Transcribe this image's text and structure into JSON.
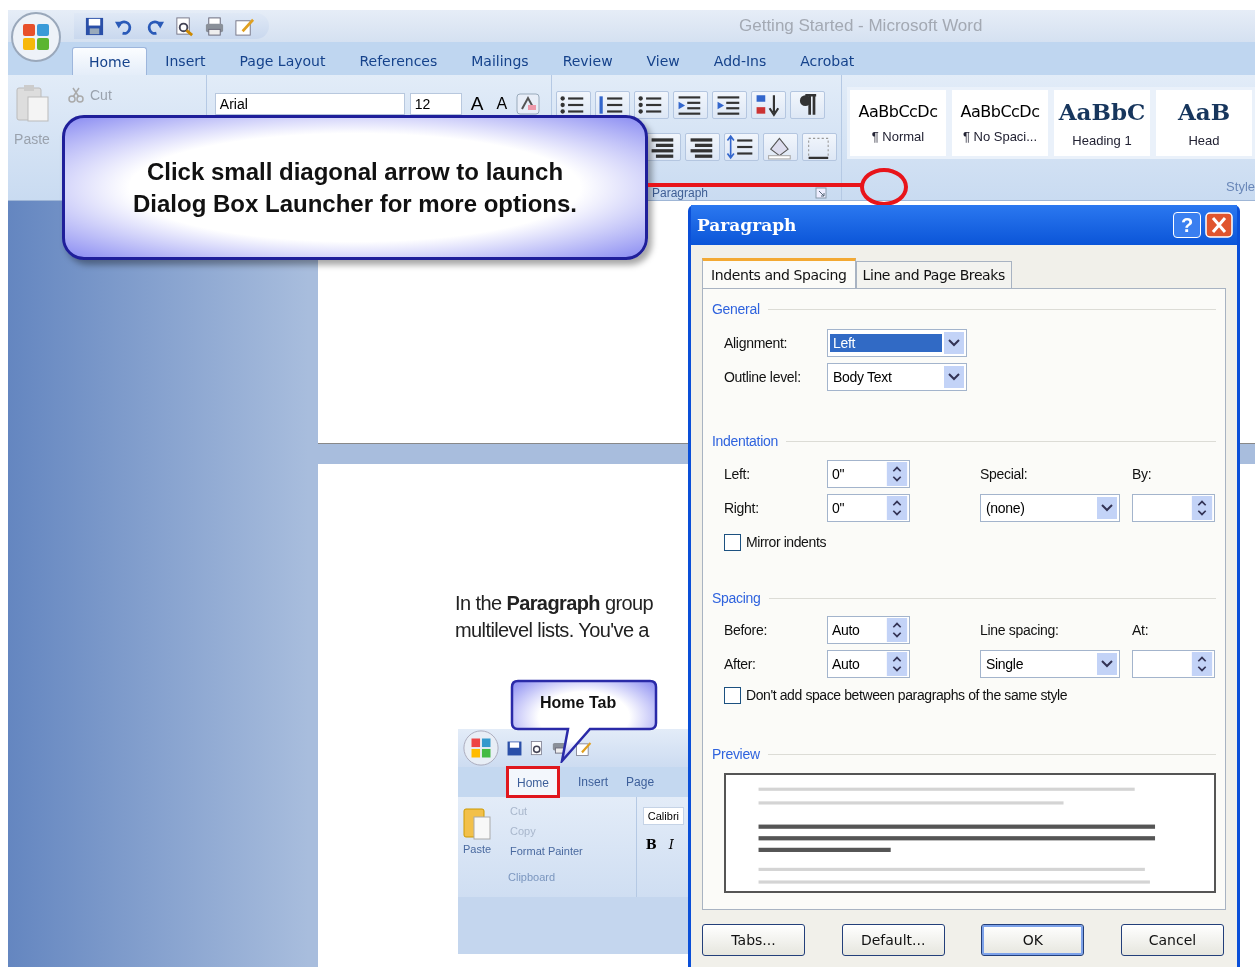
{
  "window": {
    "title": "Getting Started - Microsoft Word"
  },
  "ribbon_tabs": [
    {
      "label": "Home",
      "selected": true
    },
    {
      "label": "Insert",
      "selected": false
    },
    {
      "label": "Page Layout",
      "selected": false
    },
    {
      "label": "References",
      "selected": false
    },
    {
      "label": "Mailings",
      "selected": false
    },
    {
      "label": "Review",
      "selected": false
    },
    {
      "label": "View",
      "selected": false
    },
    {
      "label": "Add-Ins",
      "selected": false
    },
    {
      "label": "Acrobat",
      "selected": false
    }
  ],
  "ribbon": {
    "clipboard": {
      "paste": "Paste",
      "cut": "Cut"
    },
    "font": {
      "name": "Arial",
      "size": "12",
      "grow": "A",
      "shrink": "A"
    },
    "paragraph_label": "Paragraph",
    "styles": [
      {
        "sample": "AaBbCcDc",
        "name": "¶ Normal",
        "kind": "body"
      },
      {
        "sample": "AaBbCcDc",
        "name": "¶ No Spaci...",
        "kind": "body"
      },
      {
        "sample": "AaBbC",
        "name": "Heading 1",
        "kind": "heading"
      },
      {
        "sample": "AaB",
        "name": "Head",
        "kind": "heading"
      }
    ],
    "styles_label": "Style"
  },
  "callout": {
    "lines": [
      "Click small diagonal arrow to launch",
      "Dialog Box Launcher for more options."
    ]
  },
  "document": {
    "lines": [
      "In the **Paragraph** group",
      "multilevel lists. You've a"
    ],
    "screenshot": {
      "tabs": [
        {
          "label": "Home",
          "selected": true
        },
        {
          "label": "Insert",
          "selected": false
        },
        {
          "label": "Page",
          "selected": false
        }
      ],
      "paste": "Paste",
      "commands": [
        "Cut",
        "Copy",
        "Format Painter"
      ],
      "group_label": "Clipboard",
      "font": "Calibri",
      "bold": "B",
      "italic": "I"
    },
    "callout": "Home Tab"
  },
  "dialog": {
    "title": "Paragraph",
    "help": "?",
    "tabs": [
      {
        "label": "Indents and Spacing",
        "selected": true
      },
      {
        "label": "Line and Page Breaks",
        "selected": false
      }
    ],
    "sections": [
      {
        "heading": "General",
        "rows": [
          [
            {
              "kind": "label",
              "text": "Alignment:"
            },
            {
              "kind": "dropdown",
              "value": "Left",
              "highlighted": true
            }
          ],
          [
            {
              "kind": "label",
              "text": "Outline level:"
            },
            {
              "kind": "dropdown",
              "value": "Body Text",
              "highlighted": false
            }
          ]
        ]
      },
      {
        "heading": "Indentation",
        "rows": [
          [
            {
              "kind": "label",
              "text": "Left:"
            },
            {
              "kind": "spin",
              "value": "0\""
            },
            {
              "kind": "label",
              "text": "Special:"
            },
            {
              "kind": "label",
              "text": "By:"
            }
          ],
          [
            {
              "kind": "label",
              "text": "Right:"
            },
            {
              "kind": "spin",
              "value": "0\""
            },
            {
              "kind": "dropdown",
              "value": "(none)",
              "highlighted": false
            },
            {
              "kind": "spin"
            }
          ],
          [
            {
              "kind": "checkbox",
              "text": "Mirror indents",
              "checked": false
            }
          ]
        ]
      },
      {
        "heading": "Spacing",
        "rows": [
          [
            {
              "kind": "label",
              "text": "Before:"
            },
            {
              "kind": "spin",
              "value": "Auto"
            },
            {
              "kind": "label",
              "text": "Line spacing:"
            },
            {
              "kind": "label",
              "text": "At:"
            }
          ],
          [
            {
              "kind": "label",
              "text": "After:"
            },
            {
              "kind": "spin",
              "value": "Auto"
            },
            {
              "kind": "dropdown",
              "value": "Single",
              "highlighted": false
            },
            {
              "kind": "spin"
            }
          ],
          [
            {
              "kind": "checkbox",
              "text": "Don't add space between paragraphs of the same style",
              "checked": false
            }
          ]
        ]
      }
    ],
    "preview_heading": "Preview",
    "buttons": [
      {
        "label": "Tabs...",
        "default": false
      },
      {
        "label": "Default...",
        "default": false
      },
      {
        "label": "OK",
        "default": true
      },
      {
        "label": "Cancel",
        "default": false
      }
    ]
  }
}
